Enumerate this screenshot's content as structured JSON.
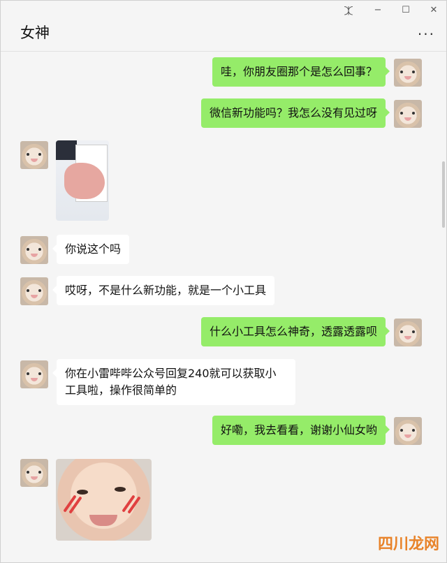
{
  "window": {
    "title": "女神",
    "controls": {
      "pin": "⯰",
      "minimize": "−",
      "maximize": "☐",
      "close": "✕"
    },
    "more_label": "···"
  },
  "messages": [
    {
      "side": "right",
      "text": "哇，你朋友圈那个是怎么回事？"
    },
    {
      "side": "right",
      "text": "微信新功能吗？我怎么没有见过呀"
    },
    {
      "side": "left",
      "type": "image",
      "image": "phone-screenshot-photo"
    },
    {
      "side": "left",
      "text": "你说这个吗"
    },
    {
      "side": "left",
      "text": "哎呀，不是什么新功能，就是一个小工具"
    },
    {
      "side": "right",
      "text": "什么小工具怎么神奇，透露透露呗"
    },
    {
      "side": "left",
      "text_lines": [
        "你在小雷哔哔公众号回复240就可以获取小",
        "工具啦，操作很简单的"
      ]
    },
    {
      "side": "right",
      "text": "好嘞，我去看看，谢谢小仙女哟"
    },
    {
      "side": "left",
      "type": "image",
      "image": "baby-face-sticker"
    }
  ],
  "watermark": "四川龙网",
  "colors": {
    "right_bubble": "#95ec69",
    "left_bubble": "#ffffff",
    "background": "#f5f5f5"
  }
}
